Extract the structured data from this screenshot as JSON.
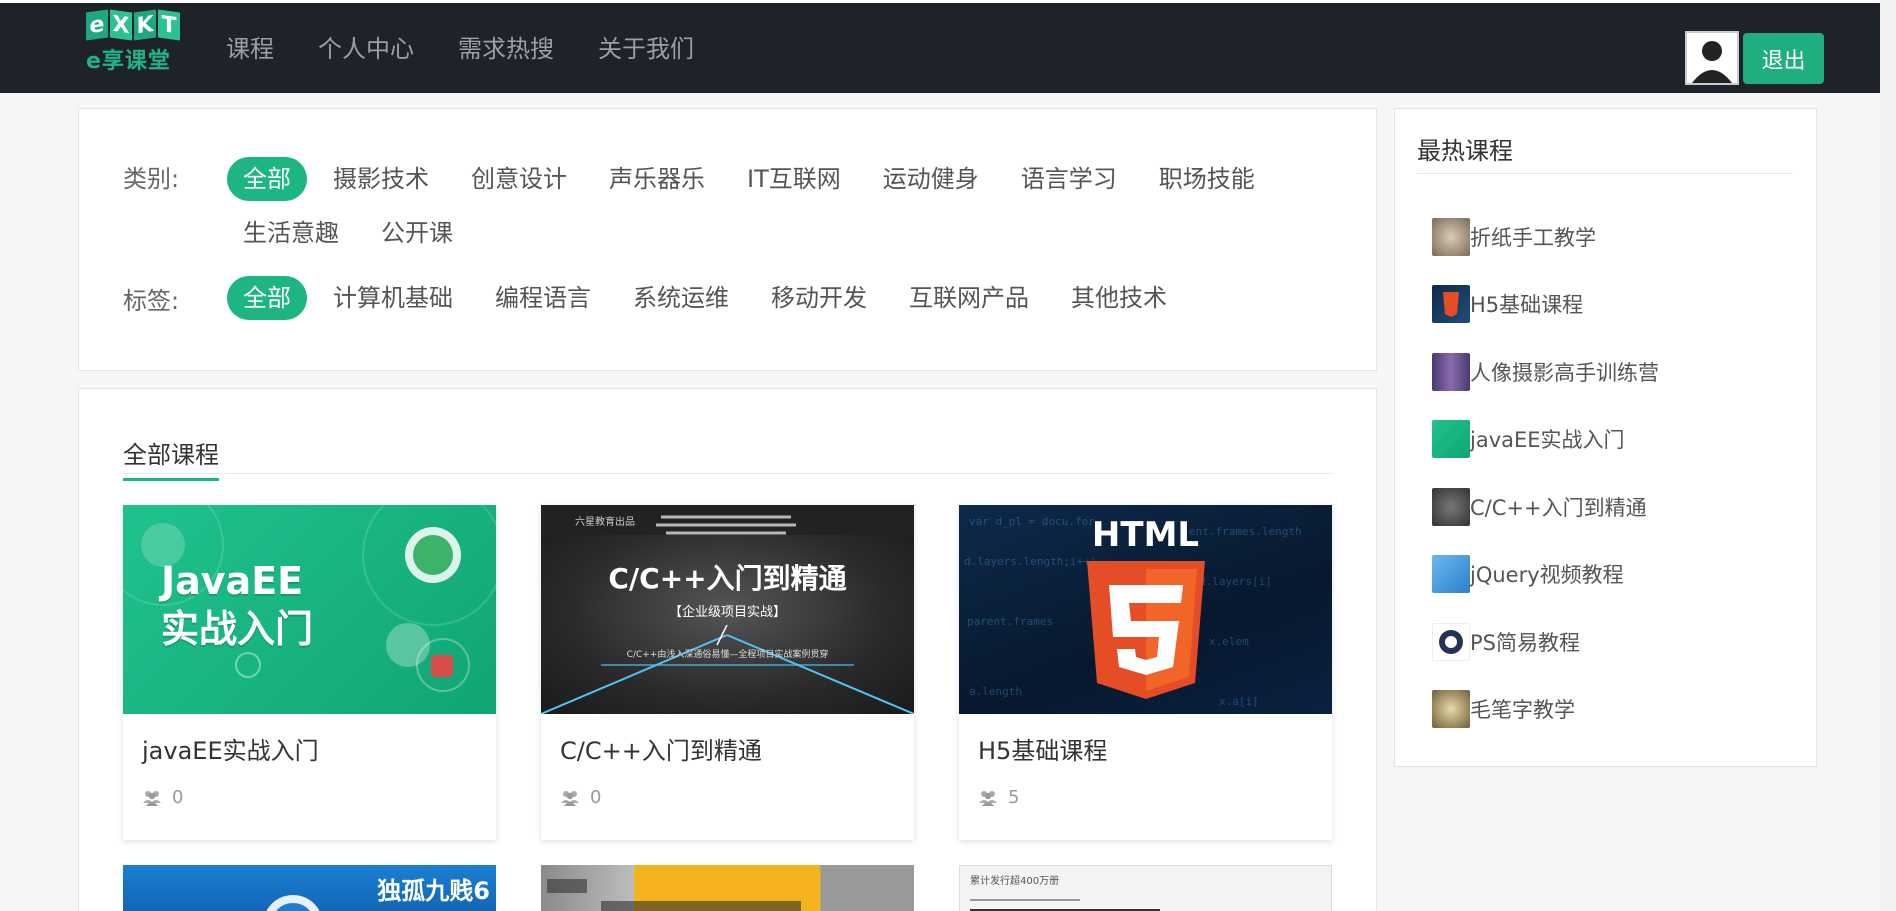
{
  "header": {
    "logo_letters": [
      "e",
      "X",
      "K",
      "T"
    ],
    "logo_text": "e享课堂",
    "nav": [
      {
        "label": "课程"
      },
      {
        "label": "个人中心"
      },
      {
        "label": "需求热搜"
      },
      {
        "label": "关于我们"
      }
    ],
    "logout_label": "退出"
  },
  "filters": {
    "category_label": "类别:",
    "categories": [
      "全部",
      "摄影技术",
      "创意设计",
      "声乐器乐",
      "IT互联网",
      "运动健身",
      "语言学习",
      "职场技能",
      "生活意趣",
      "公开课"
    ],
    "category_selected": "全部",
    "tag_label": "标签:",
    "tags": [
      "全部",
      "计算机基础",
      "编程语言",
      "系统运维",
      "移动开发",
      "互联网产品",
      "其他技术"
    ],
    "tag_selected": "全部"
  },
  "courses": {
    "title": "全部课程",
    "items": [
      {
        "name": "javaEE实战入门",
        "students": "0",
        "thumb_title": "JavaEE\n实战入门"
      },
      {
        "name": "C/C++入门到精通",
        "students": "0",
        "thumb_title": "C/C++入门到精通",
        "thumb_sub": "【企业级项目实战】",
        "thumb_badge": "六星教育出品",
        "thumb_line": "C/C++由浅入深通俗易懂—全程项目实战案例贯穿"
      },
      {
        "name": "H5基础课程",
        "students": "5",
        "thumb_title": "HTML",
        "thumb_num": "5"
      }
    ],
    "partial_thumbs": [
      {
        "text": "独孤九贱6",
        "num": ""
      },
      {
        "text": "",
        "num": ""
      },
      {
        "text": "累计发行超400万册",
        "num": ""
      }
    ]
  },
  "sidebar": {
    "title": "最热课程",
    "items": [
      {
        "label": "折纸手工教学",
        "color": "#7a6a55"
      },
      {
        "label": "H5基础课程",
        "color": "#1f4e79"
      },
      {
        "label": "人像摄影高手训练营",
        "color": "#4a3a6e"
      },
      {
        "label": "javaEE实战入门",
        "color": "#1db584"
      },
      {
        "label": "C/C++入门到精通",
        "color": "#444"
      },
      {
        "label": "jQuery视频教程",
        "color": "#3a8fd6"
      },
      {
        "label": "PS简易教程",
        "color": "#223355"
      },
      {
        "label": "毛笔字教学",
        "color": "#8a7a55"
      }
    ]
  },
  "colors": {
    "accent": "#1db584",
    "header_bg": "#1e2229"
  }
}
